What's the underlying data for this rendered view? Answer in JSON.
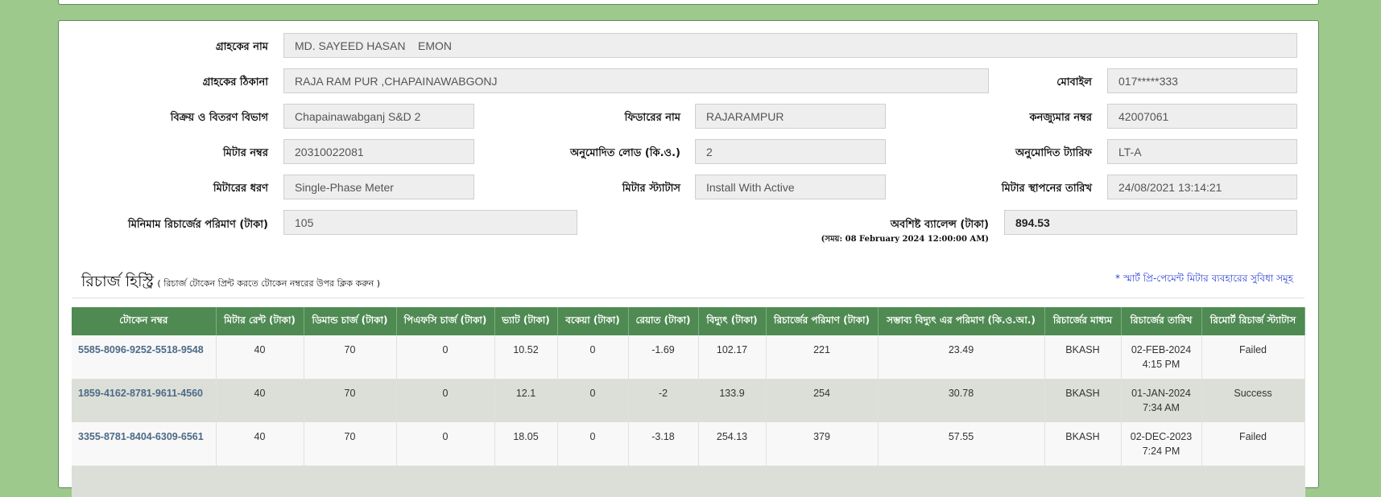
{
  "customer": {
    "name_label": "গ্রাহকের নাম",
    "name_value": "MD. SAYEED HASAN    EMON",
    "address_label": "গ্রাহকের ঠিকানা",
    "address_value": "RAJA RAM PUR  ,CHAPAINAWABGONJ",
    "mobile_label": "মোবাইল",
    "mobile_value": "017*****333",
    "division_label": "বিক্রয় ও বিতরণ বিভাগ",
    "division_value": "Chapainawabganj S&D 2",
    "feeder_label": "ফিডারের নাম",
    "feeder_value": "RAJARAMPUR",
    "consumer_label": "কনজ্যুমার নম্বর",
    "consumer_value": "42007061",
    "meter_no_label": "মিটার নম্বর",
    "meter_no_value": "20310022081",
    "load_label": "অনুমোদিত লোড (কি.ও.)",
    "load_value": "2",
    "tariff_label": "অনুমোদিত ট্যারিফ",
    "tariff_value": "LT-A",
    "meter_type_label": "মিটারের ধরণ",
    "meter_type_value": "Single-Phase Meter",
    "meter_status_label": "মিটার স্ট্যাটাস",
    "meter_status_value": "Install With Active",
    "install_date_label": "মিটার স্থাপনের তারিখ",
    "install_date_value": "24/08/2021 13:14:21",
    "min_recharge_label": "মিনিমাম রিচার্জের পরিমাণ (টাকা)",
    "min_recharge_value": "105",
    "balance_label": "অবশিষ্ট ব্যালেন্স (টাকা)",
    "balance_value": "894.53",
    "balance_asof": "(সময়: 08 February 2024 12:00:00 AM)"
  },
  "history": {
    "title": "রিচার্জ হিস্ট্রি",
    "hint": "( রিচার্জ টোকেন প্রিন্ট করতে টোকেন নম্বরের উপর ক্লিক করুন )",
    "feature_link": "* স্মার্ট প্রি-পেমেন্ট মিটার ব্যবহারের সুবিধা সমূহ",
    "columns": [
      "টোকেন নম্বর",
      "মিটার রেন্ট (টাকা)",
      "ডিমান্ড চার্জ (টাকা)",
      "পিএফসি চার্জ (টাকা)",
      "ভ্যাট (টাকা)",
      "বকেয়া (টাকা)",
      "রেয়াত (টাকা)",
      "বিদ্যুৎ (টাকা)",
      "রিচার্জের পরিমাণ (টাকা)",
      "সম্ভাব্য বিদ্যুৎ এর পরিমাণ (কি.ও.আ.)",
      "রিচার্জের মাধ্যম",
      "রিচার্জের তারিখ",
      "রিমোর্ট রিচার্জ স্ট্যাটাস"
    ],
    "rows": [
      {
        "token": "5585-8096-9252-5518-9548",
        "rent": "40",
        "demand": "70",
        "pfc": "0",
        "vat": "10.52",
        "arrear": "0",
        "rebate": "-1.69",
        "energy": "102.17",
        "amount": "221",
        "kwh": "23.49",
        "medium": "BKASH",
        "date": "02-FEB-2024",
        "time": "4:15 PM",
        "status": "Failed"
      },
      {
        "token": "1859-4162-8781-9611-4560",
        "rent": "40",
        "demand": "70",
        "pfc": "0",
        "vat": "12.1",
        "arrear": "0",
        "rebate": "-2",
        "energy": "133.9",
        "amount": "254",
        "kwh": "30.78",
        "medium": "BKASH",
        "date": "01-JAN-2024",
        "time": "7:34 AM",
        "status": "Success"
      },
      {
        "token": "3355-8781-8404-6309-6561",
        "rent": "40",
        "demand": "70",
        "pfc": "0",
        "vat": "18.05",
        "arrear": "0",
        "rebate": "-3.18",
        "energy": "254.13",
        "amount": "379",
        "kwh": "57.55",
        "medium": "BKASH",
        "date": "02-DEC-2023",
        "time": "7:24 PM",
        "status": "Failed"
      }
    ]
  }
}
